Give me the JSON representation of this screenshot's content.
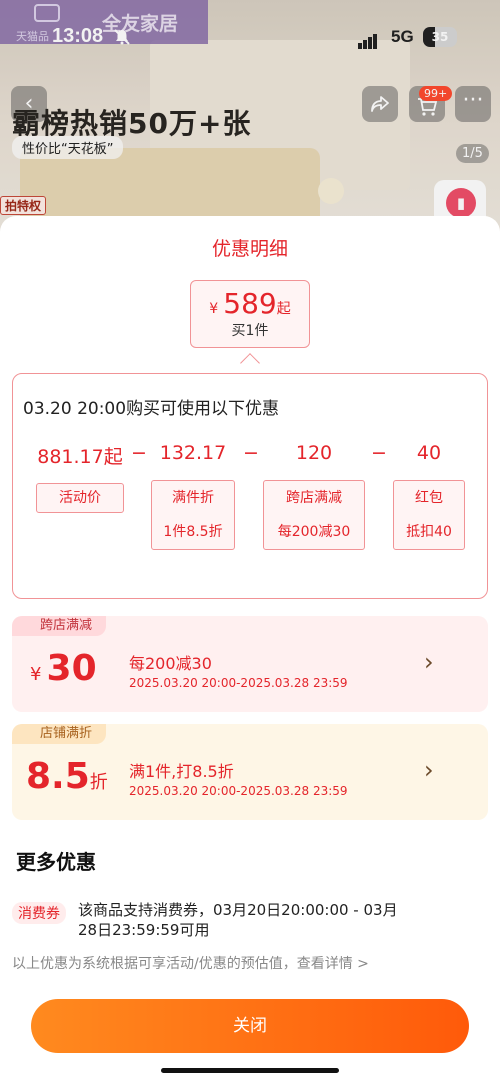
{
  "status_bar": {
    "time": "13:08",
    "network": "5G",
    "battery": "35",
    "battery_level": 0.35
  },
  "brand": {
    "logo_text": "天猫品",
    "store_name": "全友家居"
  },
  "product_header": {
    "headline": "霸榜热销50万+张",
    "subline": "性价比“天花板”",
    "cart_badge": "99+",
    "page_indicator": "1/5",
    "privilege_tag": "拍特权"
  },
  "sheet": {
    "title": "优惠明细",
    "price": {
      "currency": "¥",
      "amount": "589",
      "suffix": "起",
      "quantity": "买1件"
    },
    "calc": {
      "heading": "03.20 20:00购买可使用以下优惠",
      "items": [
        {
          "value": "881.17起",
          "label": "活动价",
          "detail": ""
        },
        {
          "value": "132.17",
          "label": "满件折",
          "detail": "1件8.5折"
        },
        {
          "value": "120",
          "label": "跨店满减",
          "detail": "每200减30"
        },
        {
          "value": "40",
          "label": "红包",
          "detail": "抵扣40"
        }
      ],
      "operator": "−"
    },
    "promos": [
      {
        "label": "跨店满减",
        "prefix": "¥",
        "value": "30",
        "suffix": "",
        "desc": "每200减30",
        "date": "2025.03.20 20:00-2025.03.28 23:59"
      },
      {
        "label": "店铺满折",
        "prefix": "",
        "value": "8.5",
        "suffix": "折",
        "desc": "满1件,打8.5折",
        "date": "2025.03.20 20:00-2025.03.28 23:59"
      }
    ],
    "more_title": "更多优惠",
    "coupon": {
      "tag": "消费券",
      "text": "该商品支持消费券，03月20日20:00:00 - 03月28日23:59:59可用"
    },
    "disclaimer": "以上优惠为系统根据可享活动/优惠的预估值，查看详情 >",
    "close_label": "关闭"
  }
}
